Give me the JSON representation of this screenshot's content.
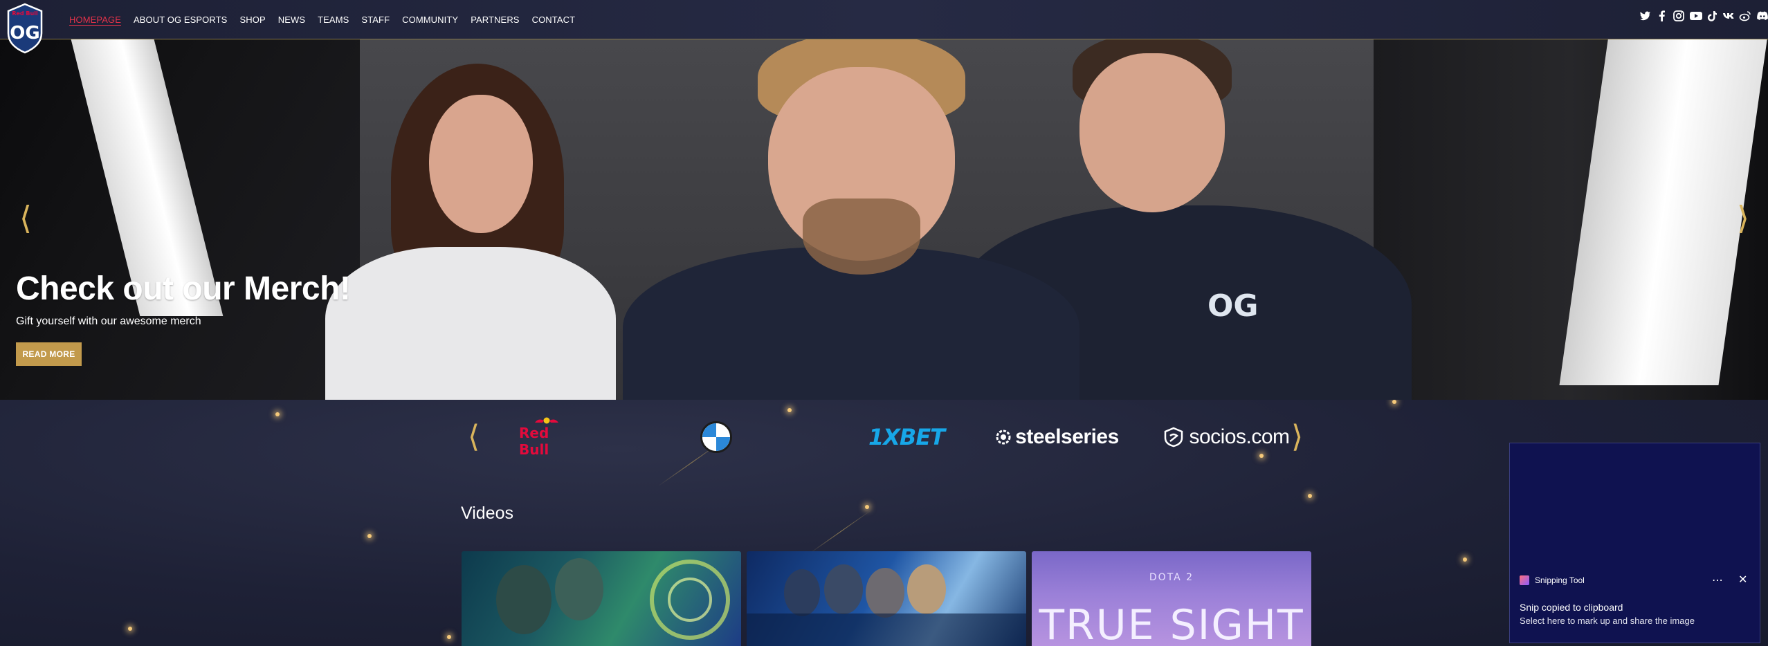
{
  "nav": {
    "logo_text": "OG",
    "items": [
      {
        "label": "HOMEPAGE",
        "active": true
      },
      {
        "label": "ABOUT OG ESPORTS",
        "active": false
      },
      {
        "label": "SHOP",
        "active": false
      },
      {
        "label": "NEWS",
        "active": false
      },
      {
        "label": "TEAMS",
        "active": false
      },
      {
        "label": "STAFF",
        "active": false
      },
      {
        "label": "COMMUNITY",
        "active": false
      },
      {
        "label": "PARTNERS",
        "active": false
      },
      {
        "label": "CONTACT",
        "active": false
      }
    ],
    "socials": [
      "twitter-icon",
      "facebook-icon",
      "instagram-icon",
      "youtube-icon",
      "tiktok-icon",
      "vk-icon",
      "weibo-icon",
      "discord-icon"
    ]
  },
  "hero": {
    "title": "Check out our Merch!",
    "subtitle": "Gift yourself with our awesome merch",
    "button_label": "READ MORE",
    "chest_logo": "OG"
  },
  "sponsors": {
    "redbull": "Red Bull",
    "xbet": "1XBET",
    "steelseries": "steelseries",
    "socios": "socios.com"
  },
  "videos": {
    "title": "Videos",
    "cards": [
      {
        "name": "video-1"
      },
      {
        "name": "video-2"
      },
      {
        "name": "video-3",
        "header": "DOTA 2",
        "title": "TRUE SIGHT"
      }
    ]
  },
  "toast": {
    "app": "Snipping Tool",
    "message": "Snip copied to clipboard",
    "sub": "Select here to mark up and share the image"
  },
  "colors": {
    "accent_gold": "#c29a4c",
    "active_nav": "#e2324a",
    "bg": "#1e2036"
  }
}
